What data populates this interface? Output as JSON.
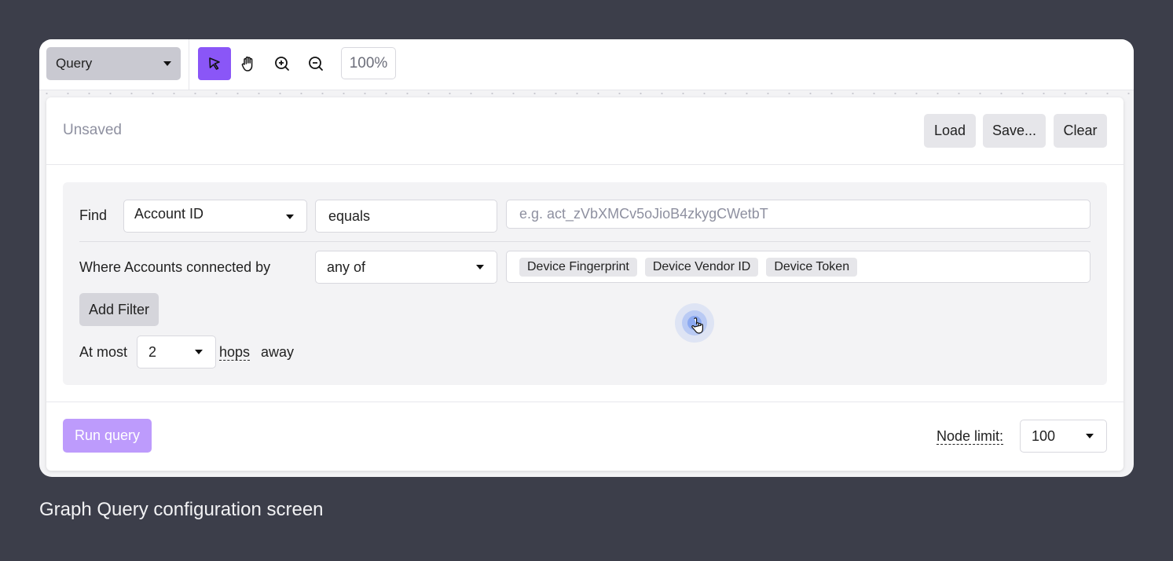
{
  "toolbar": {
    "mode_select": "Query",
    "tools": [
      {
        "name": "select-pointer",
        "active": true
      },
      {
        "name": "pan-hand",
        "active": false
      },
      {
        "name": "zoom-in",
        "active": false
      },
      {
        "name": "zoom-out",
        "active": false
      }
    ],
    "zoom_level": "100%"
  },
  "header": {
    "status": "Unsaved",
    "buttons": {
      "load": "Load",
      "save": "Save...",
      "clear": "Clear"
    }
  },
  "query": {
    "find_label": "Find",
    "find_field": "Account ID",
    "operator": "equals",
    "value_placeholder": "e.g. act_zVbXMCv5oJioB4zkygCWetbT",
    "where_label": "Where Accounts connected by",
    "match_mode": "any of",
    "connections": [
      "Device Fingerprint",
      "Device Vendor ID",
      "Device Token"
    ],
    "add_filter": "Add Filter",
    "at_most_label": "At most",
    "hops_value": "2",
    "hops_label": "hops",
    "away_label": "away"
  },
  "footer": {
    "run_query": "Run query",
    "node_limit_label": "Node limit:",
    "node_limit_value": "100"
  },
  "caption": "Graph Query configuration screen",
  "colors": {
    "accent": "#8a56f7",
    "accent_disabled": "#bd9bfc",
    "background": "#3c3e4a"
  }
}
